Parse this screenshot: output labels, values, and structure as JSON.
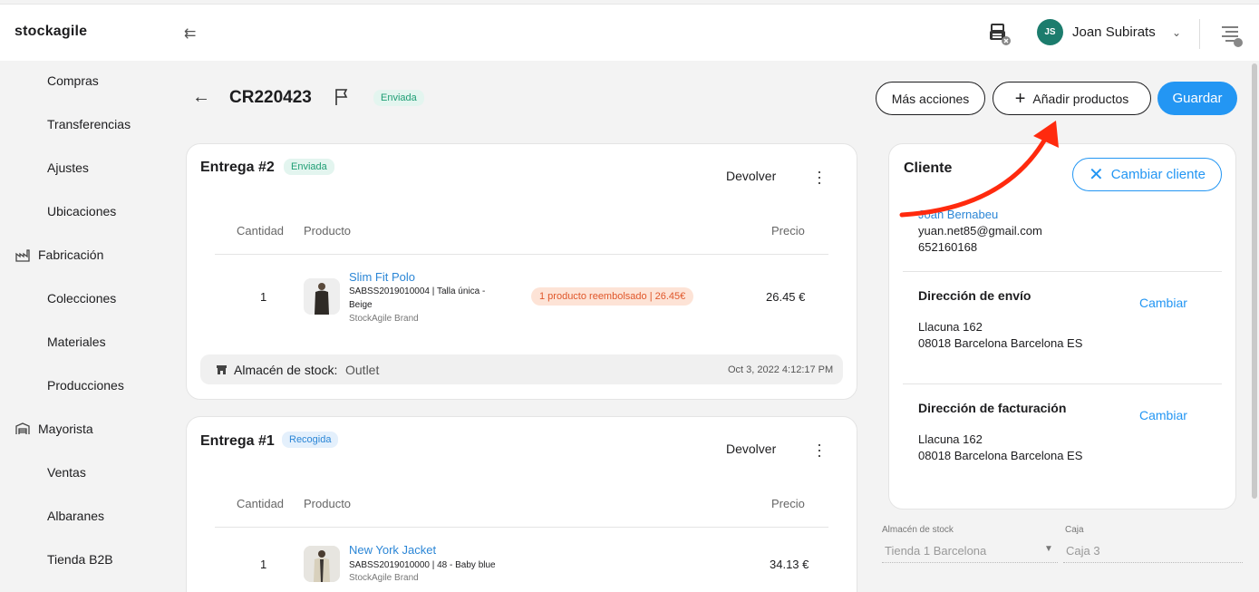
{
  "app": {
    "logo": "stockagile",
    "user_initials": "JS",
    "user_name": "Joan Subirats"
  },
  "sidebar": {
    "items": [
      {
        "label": "Compras",
        "type": "sub"
      },
      {
        "label": "Transferencias",
        "type": "sub"
      },
      {
        "label": "Ajustes",
        "type": "sub"
      },
      {
        "label": "Ubicaciones",
        "type": "sub"
      },
      {
        "label": "Fabricación",
        "type": "head",
        "icon": "factory-icon"
      },
      {
        "label": "Colecciones",
        "type": "sub"
      },
      {
        "label": "Materiales",
        "type": "sub"
      },
      {
        "label": "Producciones",
        "type": "sub"
      },
      {
        "label": "Mayorista",
        "type": "head",
        "icon": "warehouse-icon"
      },
      {
        "label": "Ventas",
        "type": "sub"
      },
      {
        "label": "Albaranes",
        "type": "sub"
      },
      {
        "label": "Tienda B2B",
        "type": "sub"
      }
    ]
  },
  "header": {
    "order_id": "CR220423",
    "status": "Enviada",
    "more_actions": "Más acciones",
    "add_products": "Añadir productos",
    "save": "Guardar"
  },
  "deliveries": [
    {
      "title": "Entrega #2",
      "status": "Enviada",
      "return_label": "Devolver",
      "col_qty": "Cantidad",
      "col_product": "Producto",
      "col_price": "Precio",
      "row": {
        "qty": "1",
        "name": "Slim Fit Polo",
        "meta_1": "SABSS2019010004 | Talla única -",
        "meta_2": "Beige",
        "brand": "StockAgile Brand",
        "refund": "1 producto reembolsado | 26.45€",
        "price": "26.45 €"
      },
      "stock_label": "Almacén de stock:",
      "stock_value": "Outlet",
      "date": "Oct 3, 2022 4:12:17 PM"
    },
    {
      "title": "Entrega #1",
      "status": "Recogida",
      "return_label": "Devolver",
      "col_qty": "Cantidad",
      "col_product": "Producto",
      "col_price": "Precio",
      "row": {
        "qty": "1",
        "name": "New York Jacket",
        "meta_1": "SABSS2019010000 | 48 - Baby blue",
        "brand": "StockAgile Brand",
        "price": "34.13 €"
      }
    }
  ],
  "client": {
    "title": "Cliente",
    "change_client": "Cambiar cliente",
    "name": "Joan Bernabeu",
    "email": "yuan.net85@gmail.com",
    "phone": "652160168",
    "shipping_title": "Dirección de envío",
    "shipping_change": "Cambiar",
    "shipping_line1": "Llacuna 162",
    "shipping_line2": "08018 Barcelona Barcelona ES",
    "billing_title": "Dirección de facturación",
    "billing_change": "Cambiar",
    "billing_line1": "Llacuna 162",
    "billing_line2": "08018 Barcelona Barcelona ES"
  },
  "bottom_fields": {
    "stock_label": "Almacén de stock",
    "stock_value": "Tienda 1 Barcelona",
    "till_label": "Caja",
    "till_value": "Caja 3"
  },
  "colors": {
    "primary": "#2396f3",
    "annotation_arrow": "#ff2a0e",
    "avatar": "#1c7c6d"
  }
}
